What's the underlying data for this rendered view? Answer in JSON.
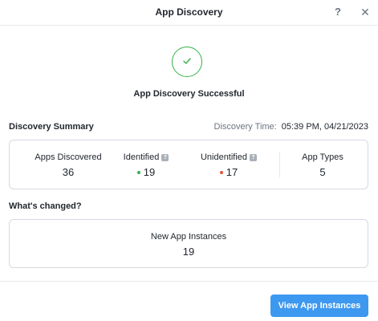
{
  "header": {
    "title": "App Discovery",
    "help_icon": "?",
    "close_icon": "✕"
  },
  "status": {
    "message": "App Discovery Successful",
    "icon": "check-icon",
    "color": "#36b24a"
  },
  "summary": {
    "title": "Discovery Summary",
    "time_label": "Discovery Time:",
    "time_value": "05:39 PM, 04/21/2023",
    "stats": {
      "discovered": {
        "label": "Apps Discovered",
        "value": "36"
      },
      "identified": {
        "label": "Identified",
        "value": "19",
        "dot_color": "#36b24a"
      },
      "unidentified": {
        "label": "Unidentified",
        "value": "17",
        "dot_color": "#e5533d"
      },
      "types": {
        "label": "App Types",
        "value": "5"
      }
    }
  },
  "changed": {
    "title": "What's changed?",
    "label": "New App Instances",
    "value": "19"
  },
  "footer": {
    "primary_button": "View App Instances",
    "primary_color": "#3d98f0"
  }
}
